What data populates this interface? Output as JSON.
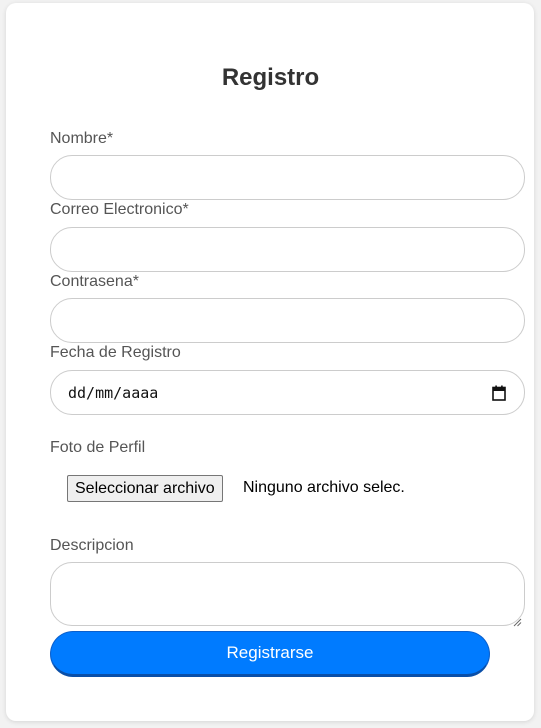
{
  "form": {
    "title": "Registro",
    "fields": {
      "nombre": {
        "label": "Nombre*",
        "value": ""
      },
      "correo": {
        "label": "Correo Electronico*",
        "value": ""
      },
      "contrasena": {
        "label": "Contrasena*",
        "value": ""
      },
      "fecha": {
        "label": "Fecha de Registro",
        "placeholder": "dd/mm/aaaa"
      },
      "foto": {
        "label": "Foto de Perfil",
        "button_label": "Seleccionar archivo",
        "status": "Ninguno archivo selec."
      },
      "descripcion": {
        "label": "Descripcion",
        "value": ""
      }
    },
    "submit_label": "Registrarse"
  },
  "colors": {
    "accent": "#007bff",
    "background": "#f2f2f2",
    "card": "#ffffff"
  },
  "icons": {
    "date_picker": "calendar-icon",
    "textarea_resize": "resize-grip-icon"
  }
}
